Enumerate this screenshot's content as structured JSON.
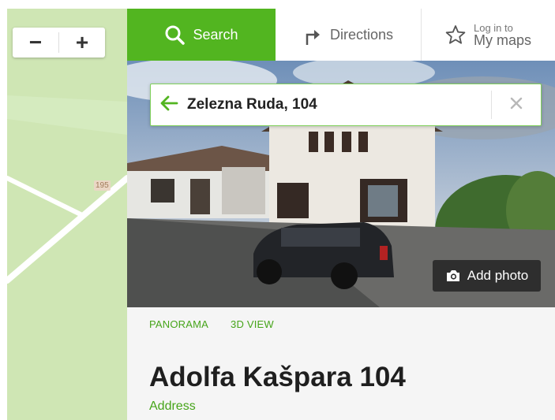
{
  "map": {
    "zoom_out_label": "−",
    "zoom_in_label": "+",
    "road_label": "195"
  },
  "topbar": {
    "search_label": "Search",
    "directions_label": "Directions",
    "login_line1": "Log in to",
    "login_line2": "My maps"
  },
  "search": {
    "value": "Zelezna Ruda, 104"
  },
  "photo": {
    "add_photo_label": "Add photo"
  },
  "place": {
    "links": [
      "PANORAMA",
      "3D VIEW"
    ],
    "title": "Adolfa Kašpara 104",
    "subtitle": "Address"
  },
  "colors": {
    "accent": "#52b520",
    "link": "#46a51a",
    "map_bg": "#cfe6b4"
  },
  "icons": {
    "search": "search-icon",
    "directions": "turn-arrow-icon",
    "login": "star-icon",
    "back": "back-arrow-icon",
    "clear": "close-icon",
    "add_photo": "camera-icon"
  }
}
